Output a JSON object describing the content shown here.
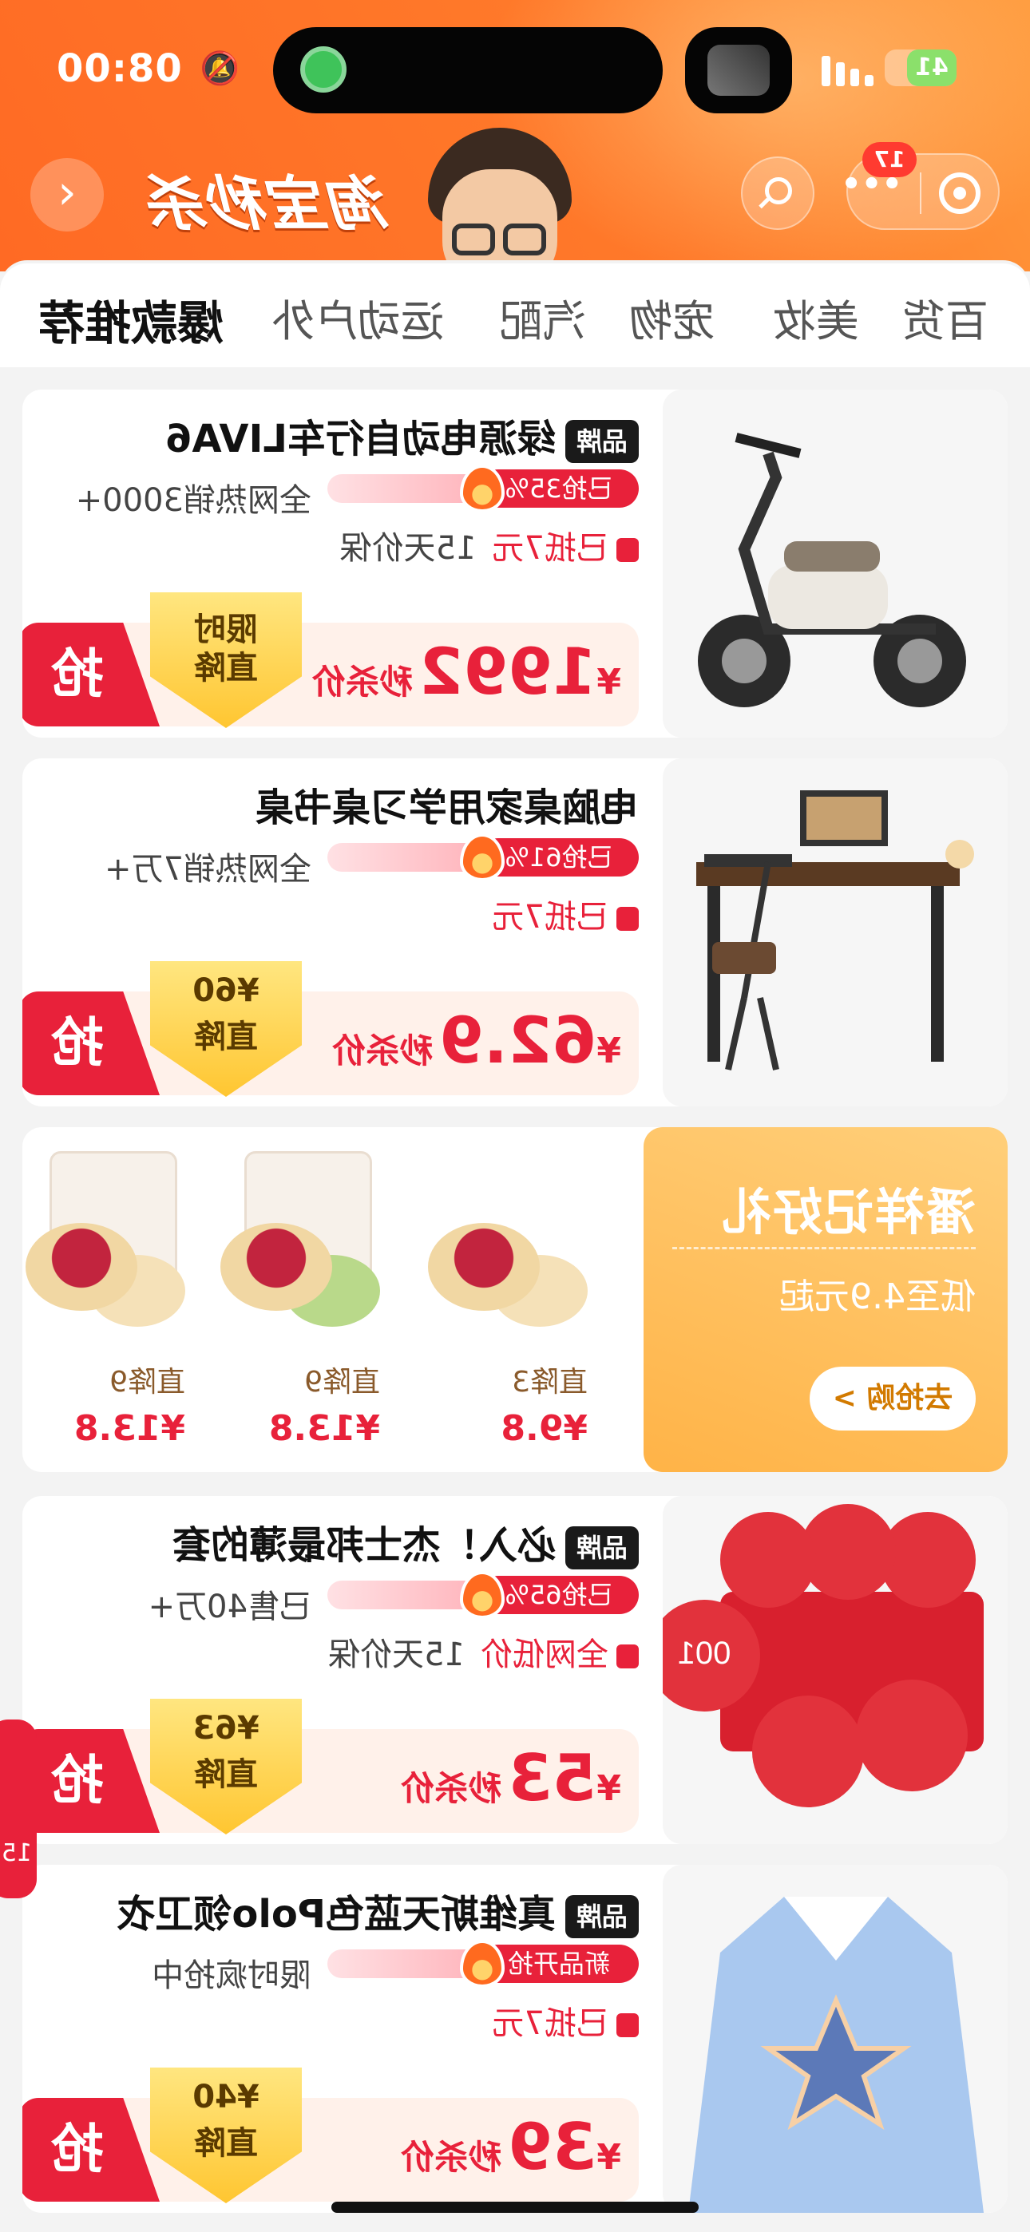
{
  "status_bar": {
    "time": "08:00",
    "battery": "41"
  },
  "header": {
    "brand": "淘宝秒杀",
    "badge_count": "17"
  },
  "tabs": [
    {
      "label": "爆款推荐",
      "active": true
    },
    {
      "label": "运动户外"
    },
    {
      "label": "汽配"
    },
    {
      "label": "宠物"
    },
    {
      "label": "美妆"
    },
    {
      "label": "百货"
    }
  ],
  "products": [
    {
      "title": "绿源电动自行车LIVA6",
      "brand_tag": "品牌",
      "grabbed": "已抢35%",
      "sold": "全网热销3000+",
      "info_red": "已抵7元",
      "info_gray": "15天价保",
      "price_symbol": "¥",
      "price": "1992",
      "price_label": "秒杀价",
      "drop_top": "限时",
      "drop_bottom": "直降",
      "buy": "抢"
    },
    {
      "title": "电脑桌家用学习桌书桌",
      "brand_tag": "",
      "grabbed": "已抢61%",
      "sold": "全网热销7万+",
      "info_red": "已抵7元",
      "info_gray": "",
      "price_symbol": "¥",
      "price": "62.9",
      "price_label": "秒杀价",
      "drop_top": "¥60",
      "drop_bottom": "直降",
      "buy": "抢"
    },
    {
      "title": "必入！杰士邦最薄的套",
      "brand_tag": "品牌",
      "grabbed": "已抢65%",
      "sold": "已售40万+",
      "info_red": "全网低价",
      "info_gray": "15天价保",
      "price_symbol": "¥",
      "price": "53",
      "price_label": "秒杀价",
      "drop_top": "¥63",
      "drop_bottom": "直降",
      "buy": "抢"
    },
    {
      "title": "真维斯天蓝色Polo领卫衣",
      "brand_tag": "品牌",
      "grabbed": "新品开抢",
      "sold": "限时疯抢中",
      "info_red": "已抵7元",
      "info_gray": "",
      "price_symbol": "¥",
      "price": "39",
      "price_label": "秒杀价",
      "drop_top": "¥40",
      "drop_bottom": "直降",
      "buy": "抢"
    }
  ],
  "promo": {
    "title": "潘祥记好礼",
    "subtitle": "低至4.9元起",
    "button": "去抢购 >",
    "items": [
      {
        "drop": "直降3",
        "price": "¥9.8"
      },
      {
        "drop": "直降9",
        "price": "¥13.8"
      },
      {
        "drop": "直降9",
        "price": "¥13.8"
      }
    ]
  },
  "float_tab": {
    "text": "15"
  }
}
